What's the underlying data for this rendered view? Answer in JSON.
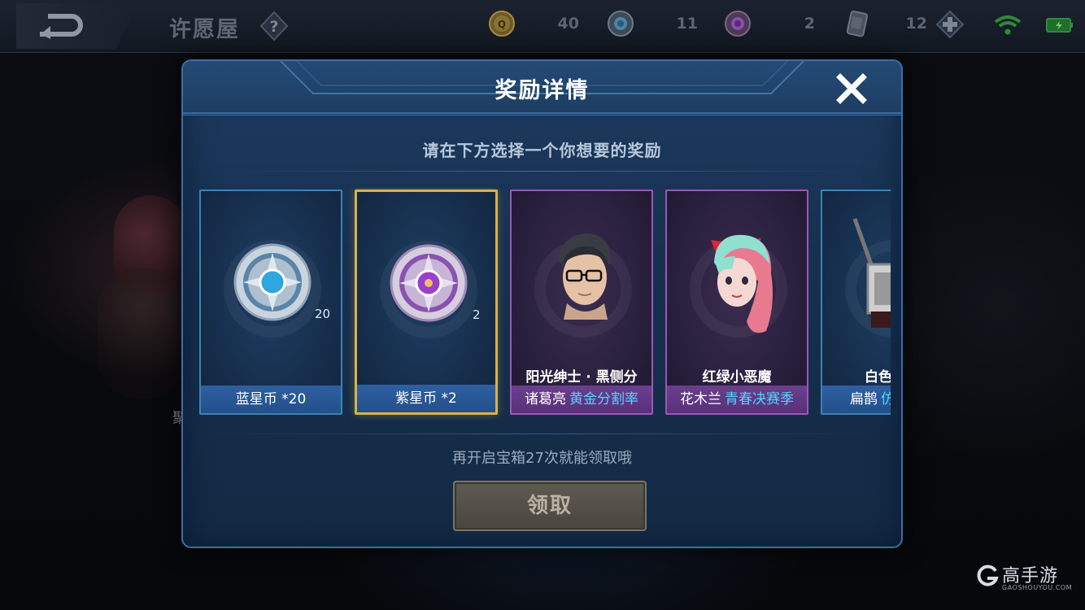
{
  "topbar": {
    "title": "许愿屋",
    "help_icon": "question-icon",
    "resources": [
      {
        "name": "voucher-coin-icon",
        "value": "40"
      },
      {
        "name": "blue-star-coin-icon",
        "value": "11"
      },
      {
        "name": "purple-star-coin-icon",
        "value": "2"
      },
      {
        "name": "card-icon",
        "value": "12"
      }
    ]
  },
  "dialog": {
    "title": "奖励详情",
    "subtitle": "请在下方选择一个你想要的奖励",
    "rewards": [
      {
        "type": "coin",
        "icon": "blue-star-coin-icon",
        "count": "20",
        "label": "蓝星币 *20"
      },
      {
        "type": "coin",
        "icon": "purple-star-coin-icon",
        "count": "2",
        "label": "紫星币 *2",
        "selected": true
      },
      {
        "type": "skin",
        "icon": "hero-portrait-icon",
        "name": "阳光绅士 · 黑侧分",
        "hero": "诸葛亮",
        "rarity": "黄金分割率"
      },
      {
        "type": "skin",
        "icon": "hero-portrait-icon",
        "name": "红绿小恶魔",
        "hero": "花木兰",
        "rarity": "青春决赛季"
      },
      {
        "type": "skin",
        "icon": "item-icon",
        "name": "白色",
        "hero": "扁鹊",
        "rarity": "仿"
      }
    ],
    "progress_text": "再开启宝箱27次就能领取哦",
    "claim_label": "领取"
  },
  "background": {
    "partial_text": "聚"
  },
  "site_logo": {
    "text": "高手游",
    "sub": "GAOSHOUYOU.COM"
  },
  "colors": {
    "selected_border": "#d8b24a",
    "rarity_text": "#4dd7ff",
    "dialog_bg": "#17304f"
  }
}
